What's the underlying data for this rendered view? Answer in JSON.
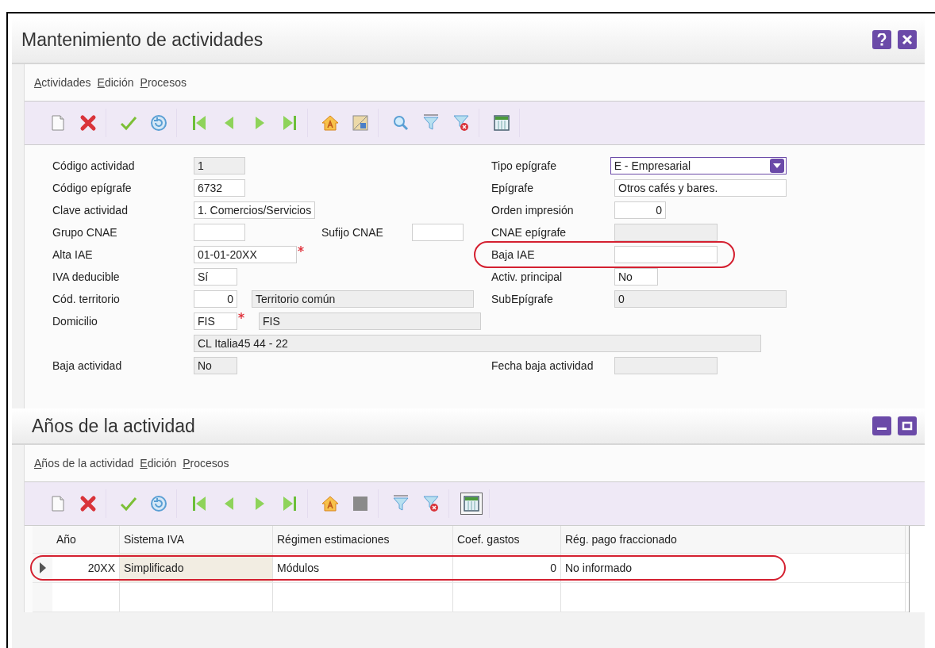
{
  "window": {
    "title": "Mantenimiento de actividades"
  },
  "menu": [
    "Actividades",
    "Edición",
    "Procesos"
  ],
  "form": {
    "rows": [
      {
        "left": [
          {
            "label": "Código actividad",
            "kind": "code",
            "value": "1",
            "readonly": true
          }
        ],
        "right": [
          {
            "label": "Tipo epígrafe",
            "kind": "select",
            "value": "E - Empresarial",
            "readonly": false
          }
        ]
      },
      {
        "left": [
          {
            "label": "Código epígrafe",
            "kind": "code",
            "value": "6732",
            "readonly": false
          }
        ],
        "right": [
          {
            "label": "Epígrafe",
            "kind": "text",
            "value": "Otros cafés y bares.",
            "readonly": false
          }
        ]
      },
      {
        "left": [
          {
            "label": "Clave actividad",
            "kind": "text",
            "value": "1. Comercios/Servicios",
            "readonly": false
          }
        ],
        "right": [
          {
            "label": "Orden impresión",
            "kind": "number",
            "value": "0",
            "readonly": false
          }
        ]
      },
      {
        "left": [
          {
            "label": "Grupo CNAE",
            "kind": "code",
            "readonly": false
          },
          {
            "label": "Sufijo CNAE",
            "kind": "code",
            "readonly": false
          }
        ],
        "right": [
          {
            "label": "CNAE epígrafe",
            "kind": "date",
            "readonly": true
          }
        ]
      },
      {
        "left": [
          {
            "label": "Alta IAE",
            "kind": "date",
            "value": "01-01-20XX",
            "readonly": false,
            "required": true
          }
        ],
        "right": [
          {
            "label": "Baja IAE",
            "kind": "date",
            "readonly": false,
            "highlighted": true
          }
        ]
      },
      {
        "left": [
          {
            "label": "IVA deducible",
            "kind": "flag",
            "value": "Sí",
            "readonly": false
          }
        ],
        "right": [
          {
            "label": "Activ. principal",
            "kind": "flag",
            "value": "No",
            "readonly": false
          }
        ]
      },
      {
        "left": [
          {
            "label": "Cód. territorio",
            "kind": "flagnum",
            "value": "0",
            "readonly": false
          },
          {
            "kind": "wide",
            "value": "Territorio común",
            "readonly": true
          }
        ],
        "right": [
          {
            "label": "SubEpígrafe",
            "kind": "text",
            "value": "0",
            "readonly": true
          }
        ]
      },
      {
        "left": [
          {
            "label": "Domicilio",
            "kind": "flag",
            "value": "FIS",
            "readonly": false,
            "required": true
          },
          {
            "kind": "wide",
            "value": "FIS",
            "readonly": true
          }
        ]
      },
      {
        "left": [
          {
            "kind": "address",
            "value": "CL Italia45 44 - 22",
            "readonly": true
          }
        ]
      },
      {
        "left": [
          {
            "label": "Baja actividad",
            "kind": "flag",
            "value": "No",
            "readonly": true
          }
        ],
        "right": [
          {
            "label": "Fecha baja actividad",
            "kind": "date",
            "readonly": true
          }
        ]
      }
    ]
  },
  "detail": {
    "title": "Años de la actividad",
    "menu": [
      "Años de la actividad",
      "Edición",
      "Procesos"
    ],
    "grid_view_on": true,
    "table": {
      "columns": [
        {
          "label": "Año",
          "kind": "number"
        },
        {
          "label": "Sistema IVA",
          "kind": "text"
        },
        {
          "label": "Régimen estimaciones",
          "kind": "text"
        },
        {
          "label": "Coef. gastos",
          "kind": "number"
        },
        {
          "label": "Rég. pago fraccionado",
          "kind": "text"
        }
      ],
      "rows": [
        {
          "current": true,
          "highlighted": true,
          "cells": [
            {
              "text": "20XX",
              "selected": false
            },
            {
              "text": "Simplificado",
              "selected": true
            },
            {
              "text": "Módulos",
              "selected": false
            },
            {
              "text": "0",
              "selected": false
            },
            {
              "text": "No informado",
              "selected": false
            }
          ]
        },
        {}
      ]
    }
  }
}
